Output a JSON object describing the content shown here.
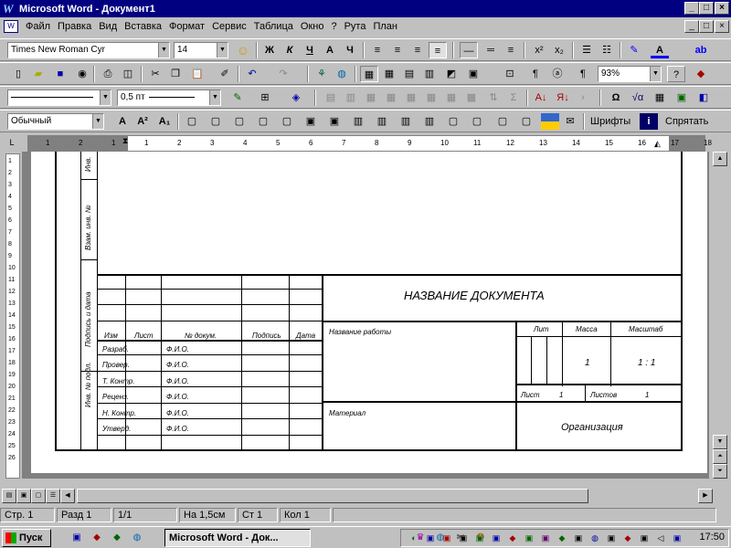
{
  "window": {
    "title": "Microsoft Word - Документ1"
  },
  "menu": [
    "Файл",
    "Правка",
    "Вид",
    "Вставка",
    "Формат",
    "Сервис",
    "Таблица",
    "Окно",
    "?",
    "Рута",
    "План"
  ],
  "toolbar1": {
    "font": "Times New Roman Cyr",
    "size": "14",
    "bold": "Ж",
    "italic": "К",
    "underline": "Ч"
  },
  "toolbar2": {
    "zoom": "93%"
  },
  "toolbar3": {
    "line_width": "0,5 пт"
  },
  "toolbar4": {
    "style": "Обычный",
    "fonts_label": "Шрифты",
    "help_label": "Спрятать"
  },
  "ruler": {
    "numbers": [
      "1",
      "2",
      "1",
      "1",
      "2",
      "3",
      "4",
      "5",
      "6",
      "7",
      "8",
      "9",
      "10",
      "11",
      "12",
      "13",
      "14",
      "15",
      "16",
      "17",
      "18"
    ]
  },
  "vruler": {
    "numbers": [
      "1",
      "2",
      "3",
      "4",
      "5",
      "6",
      "7",
      "8",
      "9",
      "10",
      "11",
      "12",
      "13",
      "14",
      "15",
      "16",
      "17",
      "18",
      "19",
      "20",
      "21",
      "22",
      "23",
      "24",
      "25",
      "26"
    ]
  },
  "stamp": {
    "title": "НАЗВАНИЕ ДОКУМЕНТА",
    "left_labels": [
      "Инв. № подл.",
      "Подпись и дата",
      "Взам. инв. №",
      "Инв."
    ],
    "headers": [
      "Изм",
      "Лист",
      "№ докум.",
      "Подпись",
      "Дата"
    ],
    "rows": [
      {
        "role": "Разраб.",
        "name": "Ф.И.О."
      },
      {
        "role": "Провер.",
        "name": "Ф.И.О."
      },
      {
        "role": "Т. Контр.",
        "name": "Ф.И.О."
      },
      {
        "role": "Реценз.",
        "name": "Ф.И.О."
      },
      {
        "role": "Н. Контр.",
        "name": "Ф.И.О."
      },
      {
        "role": "Утверд.",
        "name": "Ф.И.О."
      }
    ],
    "work_name": "Название работы",
    "lit": "Лит",
    "mass": "Масса",
    "scale": "Масштаб",
    "mass_value": "1",
    "scale_value": "1 : 1",
    "sheet": "Лист",
    "sheet_value": "1",
    "sheets": "Листов",
    "sheets_value": "1",
    "material": "Материал",
    "org": "Организация"
  },
  "status": {
    "page": "Стр. 1",
    "section": "Разд 1",
    "pages": "1/1",
    "at": "На 1,5см",
    "line": "Ст 1",
    "col": "Кол 1"
  },
  "taskbar": {
    "start": "Пуск",
    "app": "Microsoft Word - Док...",
    "clock": "17:50"
  }
}
